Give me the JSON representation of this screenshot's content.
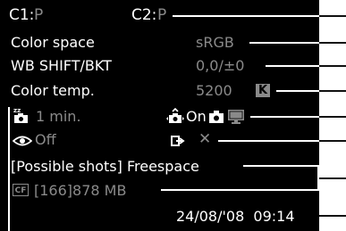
{
  "top": {
    "c1_label": "C1:",
    "c1_value": "P",
    "c2_label": "C2:",
    "c2_value": "P"
  },
  "rows": {
    "color_space_label": "Color space",
    "color_space_value": "sRGB",
    "wb_label": "WB SHIFT/BKT",
    "wb_value": "0,0/±0",
    "color_temp_label": "Color temp.",
    "color_temp_value": "5200",
    "color_temp_badge": "K",
    "auto_power_off_value": "1 min.",
    "auto_rotate_value": "On",
    "red_eye_value": "Off",
    "direct_print_value": "✕",
    "possible_shots_label": "[Possible shots] Freespace",
    "card_badge": "CF",
    "card_value": "[166]878 MB",
    "datetime_value": "24/08/'08  09:14"
  },
  "icons": {
    "auto_power_off": "zz-camera-icon",
    "auto_rotate": "rotate-camera-icon",
    "camera": "camera-icon",
    "monitor": "monitor-icon",
    "red_eye": "eye-icon",
    "print": "print-transfer-icon",
    "card": "cf-card-icon"
  },
  "colors": {
    "background": "#000000",
    "text_primary": "#ffffff",
    "text_secondary": "#8a8a8a"
  }
}
